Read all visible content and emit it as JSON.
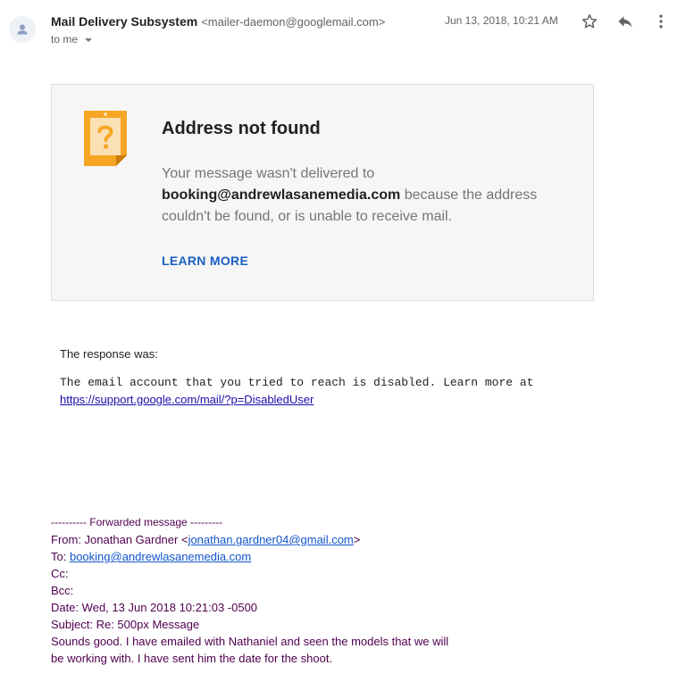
{
  "header": {
    "sender_name": "Mail Delivery Subsystem",
    "sender_email": "<mailer-daemon@googlemail.com>",
    "recipient_label": "to me",
    "date": "Jun 13, 2018, 10:21 AM",
    "icons": {
      "avatar": "person-icon",
      "star": "star-icon",
      "reply": "reply-icon",
      "more": "more-vert-icon",
      "recipient_toggle": "chevron-down-icon"
    }
  },
  "bounce": {
    "icon": "question-note-icon",
    "title": "Address not found",
    "body_pre": "Your message wasn't delivered to",
    "address": "booking@andrewlasanemedia.com",
    "body_post": "because the address couldn't be found, or is unable to receive mail.",
    "learn_more": "LEARN MORE"
  },
  "response": {
    "label": "The response was:",
    "text": "The email account that you tried to reach is disabled. Learn more at",
    "link": "https://support.google.com/mail/?p=DisabledUser"
  },
  "forwarded": {
    "separator": "---------- Forwarded message ---------",
    "from_label": "From: Jonathan Gardner <",
    "from_email": "jonathan.gardner04@gmail.com",
    "from_suffix": ">",
    "to_label": "To:",
    "to_email": "booking@andrewlasanemedia.com",
    "cc": "Cc:",
    "bcc": "Bcc:",
    "date": "Date: Wed, 13 Jun 2018 10:21:03 -0500",
    "subject": "Subject: Re: 500px Message",
    "body": "Sounds good. I have emailed with Nathaniel and seen the models that we will be working with. I have sent him the date for the shoot."
  },
  "colors": {
    "accent_link": "#1a5fc2",
    "note_orange": "#f6a623",
    "forwarded_text": "#500050"
  }
}
